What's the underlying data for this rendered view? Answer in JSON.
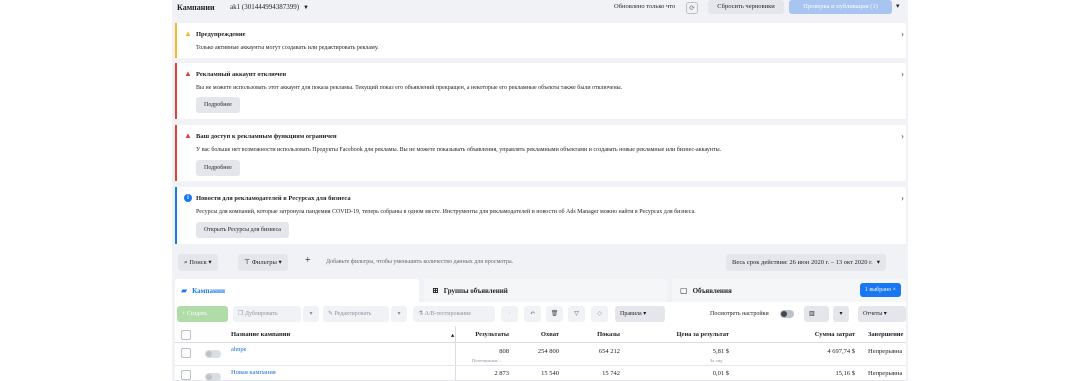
{
  "topbar": {
    "title": "Кампании",
    "account": "ak1 (301444994387399)",
    "updated": "Обновлено только что",
    "reset_drafts": "Сбросить черновики",
    "review_publish": "Проверка и публикация (1)",
    "refresh_icon": "refresh-icon"
  },
  "notices": [
    {
      "type": "warning",
      "title": "Предупреждение",
      "text": "Только активные аккаунты могут создавать или редактировать рекламу.",
      "color": "#f7b928"
    },
    {
      "type": "error",
      "title": "Рекламный аккаунт отключен",
      "text": "Вы не можете использовать этот аккаунт для показа рекламы. Текущий показ его объявлений прекращен, а некоторые его рекламные объекты также были отключены.",
      "button": "Подробнее",
      "color": "#e4403a"
    },
    {
      "type": "error",
      "title": "Ваш доступ к рекламным функциям ограничен",
      "text": "У вас больше нет возможности использовать Продукты Facebook для рекламы. Вы не можете показывать объявления, управлять рекламными объектами и создавать новые рекламные или бизнес-аккаунты.",
      "button": "Подробнее",
      "color": "#e4403a"
    },
    {
      "type": "info",
      "title": "Новости для рекламодателей в Ресурсах для бизнеса",
      "text": "Ресурсы для компаний, которые затронула пандемия COVID-19, теперь собраны в одном месте. Инструменты для рекламодателей и новости об Ads Manager можно найти в Ресурсах для бизнеса.",
      "button": "Открыть Ресурсы для бизнеса",
      "color": "#1877f2"
    }
  ],
  "filters": {
    "search": "Поиск",
    "filters": "Фильтры",
    "hint": "Добавьте фильтры, чтобы уменьшить количество данных для просмотра.",
    "date_range": "Весь срок действия: 26 июн 2020 г. – 13 окт 2020 г."
  },
  "tabs": {
    "campaigns": "Кампании",
    "adsets": "Группы объявлений",
    "ads": "Объявления",
    "selected": "1 выбрано"
  },
  "toolbar": {
    "create": "+ Создать",
    "duplicate": "Дублировать",
    "edit": "Редактировать",
    "ab_test": "A/B-тестирование",
    "rules": "Правила",
    "view_settings": "Посмотреть настройки",
    "reports": "Отчеты"
  },
  "table": {
    "headers": {
      "name": "Название кампании",
      "results": "Результаты",
      "reach": "Охват",
      "impressions": "Показы",
      "cost_per_result": "Цена за результат",
      "amount_spent": "Сумма затрат",
      "ends": "Завершение"
    },
    "rows": [
      {
        "name": "ahnpe",
        "results": "808",
        "results_sub": "Потенциальн...",
        "reach": "254 800",
        "impressions": "654 212",
        "cost_per_result": "5,81 $",
        "cost_sub": "За лид",
        "amount_spent": "4 697,74 $",
        "ends": "Непрерывна"
      },
      {
        "name": "Новая кампания",
        "results": "2 873",
        "reach": "15 540",
        "impressions": "15 742",
        "cost_per_result": "0,01 $",
        "amount_spent": "15,16 $",
        "ends": "Непрерывна"
      }
    ]
  }
}
